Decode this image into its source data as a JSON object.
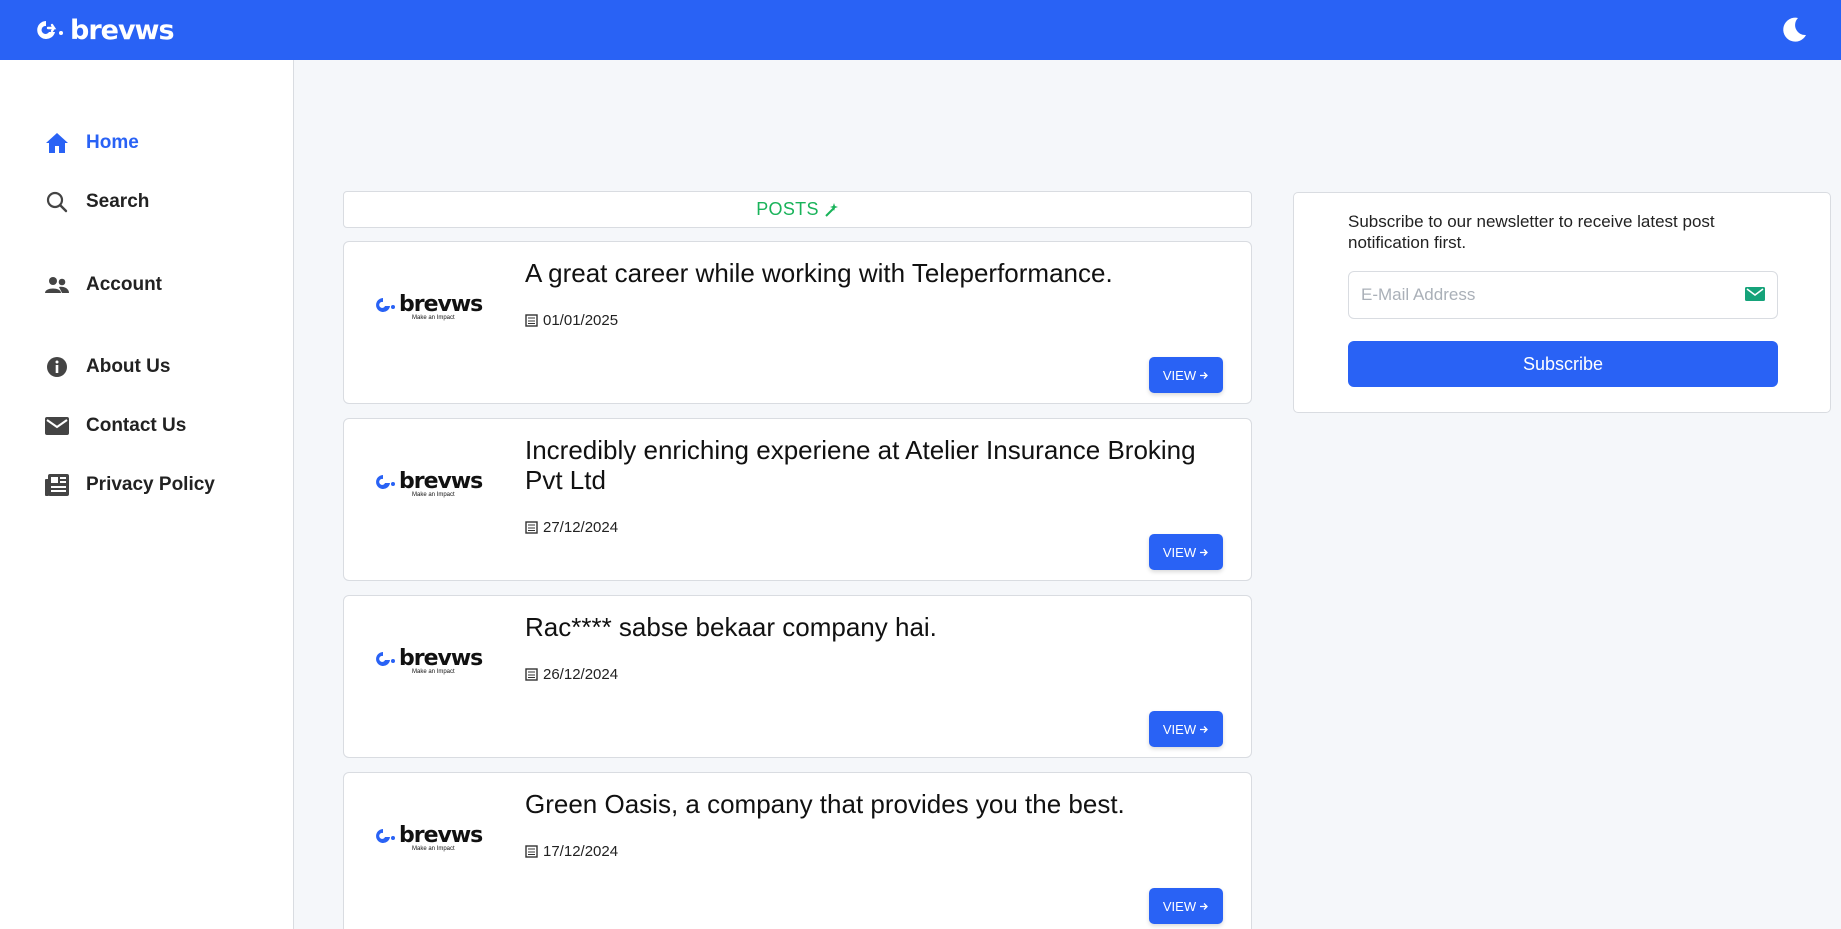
{
  "brand": {
    "name": "brevws",
    "tagline": "Make an Impact"
  },
  "colors": {
    "primary": "#2962f5",
    "accent_green": "#19b35a"
  },
  "header": {
    "theme_toggle_icon": "moon-icon"
  },
  "sidebar": {
    "items": [
      {
        "label": "Home",
        "icon": "home-icon",
        "active": true
      },
      {
        "label": "Search",
        "icon": "search-icon",
        "active": false
      },
      {
        "label": "Account",
        "icon": "users-icon",
        "active": false
      },
      {
        "label": "About Us",
        "icon": "info-icon",
        "active": false
      },
      {
        "label": "Contact Us",
        "icon": "mail-icon",
        "active": false
      },
      {
        "label": "Privacy Policy",
        "icon": "newspaper-icon",
        "active": false
      }
    ]
  },
  "posts": {
    "header": "POSTS",
    "items": [
      {
        "title": "A great career while working with Teleperformance.",
        "date": "01/01/2025",
        "button": "VIEW"
      },
      {
        "title": "Incredibly enriching experiene at Atelier Insurance Broking Pvt Ltd",
        "date": "27/12/2024",
        "button": "VIEW"
      },
      {
        "title": "Rac**** sabse bekaar company hai.",
        "date": "26/12/2024",
        "button": "VIEW"
      },
      {
        "title": "Green Oasis, a company that provides you the best.",
        "date": "17/12/2024",
        "button": "VIEW"
      }
    ]
  },
  "newsletter": {
    "message": "Subscribe to our newsletter to receive latest post notification first.",
    "email_placeholder": "E-Mail Address",
    "email_value": "",
    "button": "Subscribe"
  }
}
